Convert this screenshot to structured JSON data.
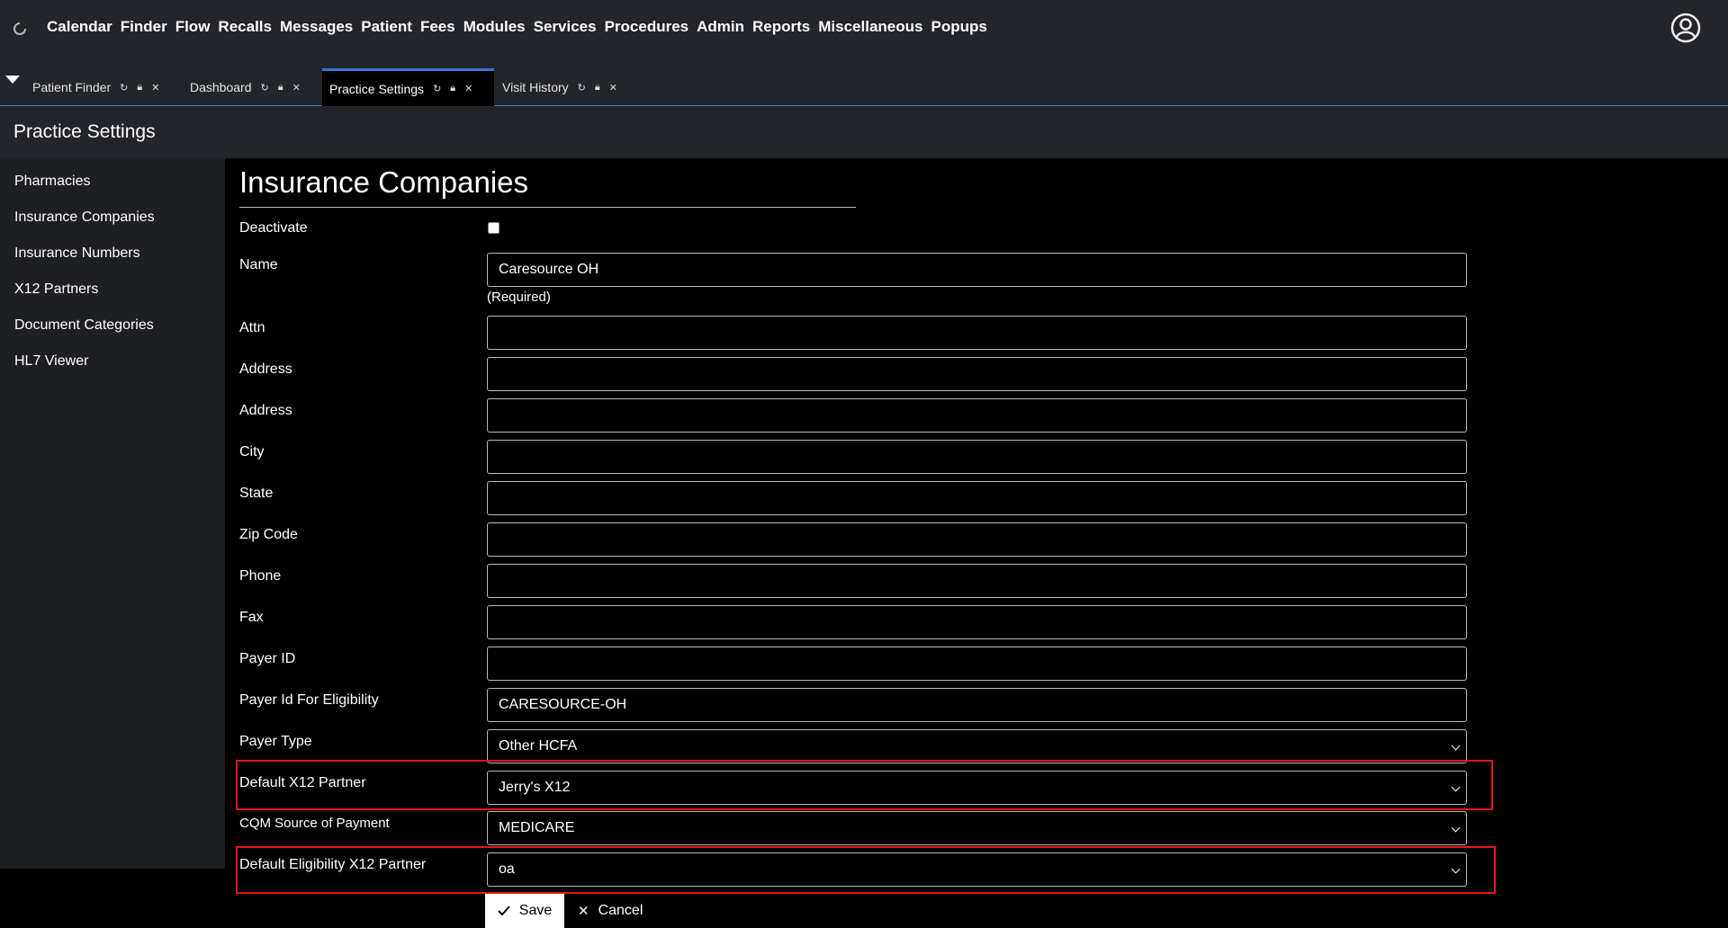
{
  "nav": {
    "menu": [
      "Calendar",
      "Finder",
      "Flow",
      "Recalls",
      "Messages",
      "Patient",
      "Fees",
      "Modules",
      "Services",
      "Procedures",
      "Admin",
      "Reports",
      "Miscellaneous",
      "Popups"
    ]
  },
  "tabs": [
    {
      "label": "Patient Finder",
      "active": false
    },
    {
      "label": "Dashboard",
      "active": false
    },
    {
      "label": "Practice Settings",
      "active": true
    },
    {
      "label": "Visit History",
      "active": false
    }
  ],
  "page": {
    "title": "Practice Settings"
  },
  "sidebar": {
    "items": [
      "Pharmacies",
      "Insurance Companies",
      "Insurance Numbers",
      "X12 Partners",
      "Document Categories",
      "HL7 Viewer"
    ]
  },
  "form": {
    "heading": "Insurance Companies",
    "deactivate_label": "Deactivate",
    "name_label": "Name",
    "name_value": "Caresource OH",
    "required_note": "(Required)",
    "attn_label": "Attn",
    "address1_label": "Address",
    "address2_label": "Address",
    "city_label": "City",
    "state_label": "State",
    "zip_label": "Zip Code",
    "phone_label": "Phone",
    "fax_label": "Fax",
    "payer_id_label": "Payer ID",
    "payer_elig_label": "Payer Id For Eligibility",
    "payer_elig_value": "CARESOURCE-OH",
    "payer_type_label": "Payer Type",
    "payer_type_value": "Other HCFA",
    "x12_partner_label": "Default X12 Partner",
    "x12_partner_value": "Jerry's X12",
    "cqm_label": "CQM Source of Payment",
    "cqm_value": "MEDICARE",
    "elig_x12_label": "Default Eligibility X12 Partner",
    "elig_x12_value": "oa"
  },
  "actions": {
    "save": "Save",
    "cancel": "Cancel"
  },
  "colors": {
    "accent": "#2f7ad8",
    "highlight": "#e8141c",
    "bar_bg": "#23252b"
  }
}
